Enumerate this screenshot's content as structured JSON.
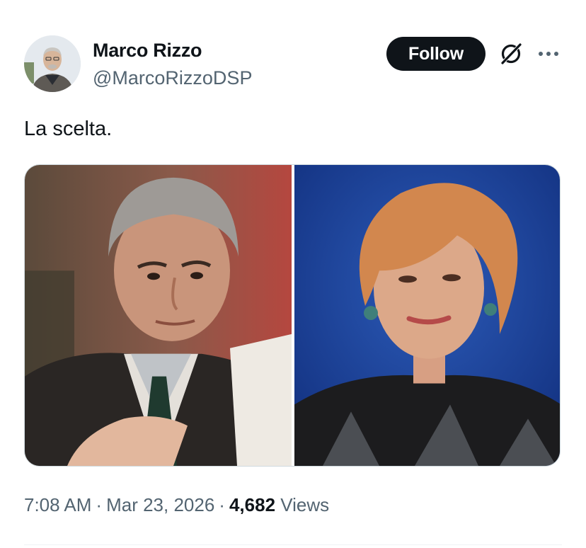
{
  "author": {
    "name": "Marco Rizzo",
    "handle": "@MarcoRizzoDSP",
    "follow_label": "Follow"
  },
  "icons": {
    "grok": "grok-icon",
    "more": "more-options-icon"
  },
  "tweet": {
    "text": "La scelta."
  },
  "media": {
    "images": [
      {
        "description_icon": "photo-older-man-with-papers"
      },
      {
        "description_icon": "photo-woman-with-short-hair"
      }
    ]
  },
  "meta": {
    "time": "7:08 AM",
    "separator": "·",
    "date": "Mar 23, 2026",
    "views_count": "4,682",
    "views_label": "Views"
  },
  "colors": {
    "text_primary": "#0f1419",
    "text_secondary": "#536471",
    "follow_button_bg": "#0f1419",
    "border": "#cfd9de"
  }
}
